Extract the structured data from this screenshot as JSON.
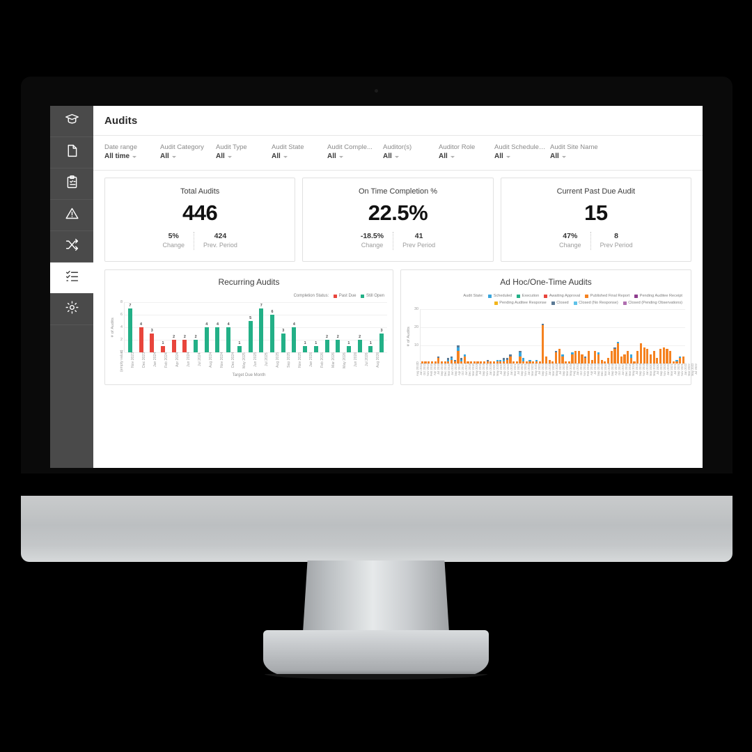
{
  "app": {
    "title": "Audits"
  },
  "sidebar": {
    "items": [
      {
        "name": "graduation-cap-icon",
        "label": "Training",
        "active": false
      },
      {
        "name": "document-icon",
        "label": "Documents",
        "active": false
      },
      {
        "name": "clipboard-icon",
        "label": "Inspections",
        "active": false
      },
      {
        "name": "warning-triangle-icon",
        "label": "Incidents",
        "active": false
      },
      {
        "name": "shuffle-icon",
        "label": "Workflows",
        "active": false
      },
      {
        "name": "checklist-icon",
        "label": "Audits",
        "active": true
      },
      {
        "name": "gear-icon",
        "label": "Settings",
        "active": false
      }
    ]
  },
  "filters": [
    {
      "label": "Date range",
      "value": "All time"
    },
    {
      "label": "Audit Category",
      "value": "All"
    },
    {
      "label": "Audit Type",
      "value": "All"
    },
    {
      "label": "Audit State",
      "value": "All"
    },
    {
      "label": "Audit Comple...",
      "value": "All"
    },
    {
      "label": "Auditor(s)",
      "value": "All"
    },
    {
      "label": "Auditor Role",
      "value": "All"
    },
    {
      "label": "Audit Schedule Type",
      "value": "All"
    },
    {
      "label": "Audit Site Name",
      "value": "All"
    }
  ],
  "kpis": [
    {
      "title": "Total Audits",
      "value": "446",
      "change": "5%",
      "change_caption": "Change",
      "prev": "424",
      "prev_caption": "Prev. Period"
    },
    {
      "title": "On Time Completion %",
      "value": "22.5%",
      "change": "-18.5%",
      "change_caption": "Change",
      "prev": "41",
      "prev_caption": "Prev Period"
    },
    {
      "title": "Current Past Due Audit",
      "value": "15",
      "change": "47%",
      "change_caption": "Change",
      "prev": "8",
      "prev_caption": "Prev Period"
    }
  ],
  "colors": {
    "past_due": "#e8453c",
    "still_open": "#23b087",
    "scheduled": "#39a5dc",
    "execution": "#23b087",
    "awaiting_approval": "#e8453c",
    "published_final_report": "#f58220",
    "pending_auditee_receipt": "#8e3d8e",
    "pending_auditee_response": "#f2b51c",
    "closed": "#5b7a95",
    "closed_no_response": "#5fc2e8",
    "closed_pending_observations": "#b06fb0",
    "sidebar_bg": "#4a4a4a",
    "card_border": "#e1e1e1"
  },
  "chart_data": [
    {
      "type": "bar",
      "title": "Recurring Audits",
      "ylabel": "# of Audits",
      "xlabel": "Target Due Month",
      "ylim": [
        0,
        8
      ],
      "yticks": [
        0,
        2,
        4,
        6,
        8
      ],
      "grid": true,
      "legend_position": "top-right",
      "legend_caption": "Completion Status:",
      "legend": [
        {
          "label": "Past Due",
          "color": "#e8453c"
        },
        {
          "label": "Still Open",
          "color": "#23b087"
        }
      ],
      "categories": [
        "(empty value)",
        "Nov 2023",
        "Dec 2023",
        "Jan 2024",
        "Feb 2024",
        "Apr 2024",
        "Jun 2024",
        "Jul 2024",
        "Aug 2024",
        "Nov 2024",
        "Dec 2024",
        "May 2025",
        "Jun 2025",
        "Jul 2025",
        "Aug 2025",
        "Sep 2025",
        "Nov 2025",
        "Jan 2026",
        "Feb 2026",
        "Mar 2026",
        "May 2026",
        "Jun 2026",
        "Jul 2026",
        "Aug 2026"
      ],
      "values": [
        7,
        4,
        3,
        1,
        2,
        2,
        2,
        4,
        4,
        4,
        1,
        5,
        7,
        6,
        3,
        4,
        1,
        1,
        2,
        2,
        1,
        2,
        1,
        3
      ],
      "point_status": [
        "Still Open",
        "Past Due",
        "Past Due",
        "Past Due",
        "Past Due",
        "Past Due",
        "Still Open",
        "Still Open",
        "Still Open",
        "Still Open",
        "Still Open",
        "Still Open",
        "Still Open",
        "Still Open",
        "Still Open",
        "Still Open",
        "Still Open",
        "Still Open",
        "Still Open",
        "Still Open",
        "Still Open",
        "Still Open",
        "Still Open",
        "Still Open"
      ]
    },
    {
      "type": "bar",
      "title": "Ad Hoc/One-Time Audits",
      "ylabel": "# of Audits",
      "ylim": [
        0,
        30
      ],
      "yticks": [
        0,
        10,
        20,
        30
      ],
      "grid": true,
      "legend_position": "top-left",
      "legend_caption": "Audit State:",
      "legend": [
        {
          "label": "Scheduled",
          "color": "#39a5dc"
        },
        {
          "label": "Execution",
          "color": "#23b087"
        },
        {
          "label": "Awaiting Approval",
          "color": "#e8453c"
        },
        {
          "label": "Published Final Report",
          "color": "#f58220"
        },
        {
          "label": "Pending Auditee Receipt",
          "color": "#8e3d8e"
        },
        {
          "label": "Pending Auditee Response",
          "color": "#f2b51c"
        },
        {
          "label": "Closed",
          "color": "#5b7a95"
        },
        {
          "label": "Closed (No Response)",
          "color": "#5fc2e8"
        },
        {
          "label": "Closed (Pending Observations)",
          "color": "#b06fb0"
        }
      ],
      "categories": [
        "Aug 2012",
        "Jan 2013",
        "Oct 2013",
        "Nov 2014",
        "Feb 2015",
        "Apr 2015",
        "Jul 2015",
        "Sep 2015",
        "Dec 2015",
        "Mar 2016",
        "Jun 2016",
        "Sep 2016",
        "Apr 2017",
        "Oct 2017",
        "Jun 2017",
        "Dec 2018",
        "Mar 2018",
        "May 2019",
        "Jul 2019",
        "Sep 2019",
        "Nov 2019",
        "Jan 2020",
        "Mar 2020",
        "May 2020",
        "Jul 2020",
        "Sep 2020",
        "Nov 2020",
        "Jan 2021",
        "Mar 2021",
        "Jul 2021",
        "Sep 2021",
        "Nov 2021",
        "Jan 2022",
        "Mar 2022",
        "May 2022",
        "Jul 2022",
        "Sep 2022",
        "Nov 2022",
        "Jan 2023",
        "Mar 2023",
        "May 2023",
        "Jul 2023",
        "Sep 2023",
        "Mar 2024",
        "May 2024"
      ],
      "series": [
        {
          "name": "Published Final Report",
          "color": "#f58220",
          "values": [
            1,
            1,
            1,
            1,
            1,
            3,
            1,
            1,
            1,
            2,
            1,
            7,
            1,
            4,
            1,
            1,
            1,
            1,
            1,
            1,
            1,
            1,
            1,
            1,
            1,
            1,
            2,
            4,
            1,
            1,
            4,
            1,
            1,
            1,
            1,
            1,
            1,
            21,
            4,
            2,
            1,
            6,
            8,
            4,
            1,
            1,
            5,
            7,
            7,
            5,
            3,
            7,
            2,
            7,
            5,
            2,
            1,
            3,
            7,
            8,
            11,
            4,
            5,
            7,
            3,
            1,
            7,
            11,
            9,
            8,
            5,
            7,
            3,
            8,
            9,
            8,
            7,
            1,
            1,
            3,
            4
          ]
        },
        {
          "name": "Scheduled",
          "color": "#39a5dc",
          "values": [
            0,
            0,
            0,
            0,
            0,
            0,
            0,
            0,
            1,
            1,
            0,
            2,
            1,
            1,
            0,
            0,
            0,
            0,
            0,
            0,
            0,
            0,
            0,
            1,
            1,
            1,
            0,
            0,
            0,
            0,
            2,
            2,
            0,
            1,
            0,
            1,
            0,
            0,
            0,
            0,
            0,
            0,
            0,
            1,
            0,
            0,
            1,
            0,
            0,
            0,
            0,
            0,
            0,
            0,
            1,
            0,
            0,
            0,
            0,
            0,
            1,
            0,
            0,
            0,
            2,
            0,
            0,
            0,
            0,
            0,
            0,
            0,
            0,
            0,
            0,
            0,
            0,
            0,
            1,
            1,
            0
          ]
        },
        {
          "name": "Closed",
          "color": "#5b7a95",
          "values": [
            0,
            0,
            0,
            0,
            0,
            1,
            0,
            0,
            1,
            1,
            1,
            1,
            1,
            0,
            0,
            0,
            0,
            0,
            0,
            0,
            1,
            0,
            0,
            0,
            0,
            1,
            1,
            1,
            0,
            0,
            1,
            0,
            0,
            0,
            0,
            0,
            0,
            1,
            0,
            0,
            0,
            1,
            0,
            0,
            0,
            0,
            0,
            0,
            0,
            0,
            1,
            0,
            0,
            0,
            0,
            0,
            0,
            0,
            0,
            1,
            0,
            0,
            0,
            0,
            0,
            0,
            0,
            0,
            0,
            0,
            0,
            0,
            0,
            0,
            0,
            0,
            0,
            0,
            0,
            0,
            0
          ]
        }
      ]
    }
  ]
}
